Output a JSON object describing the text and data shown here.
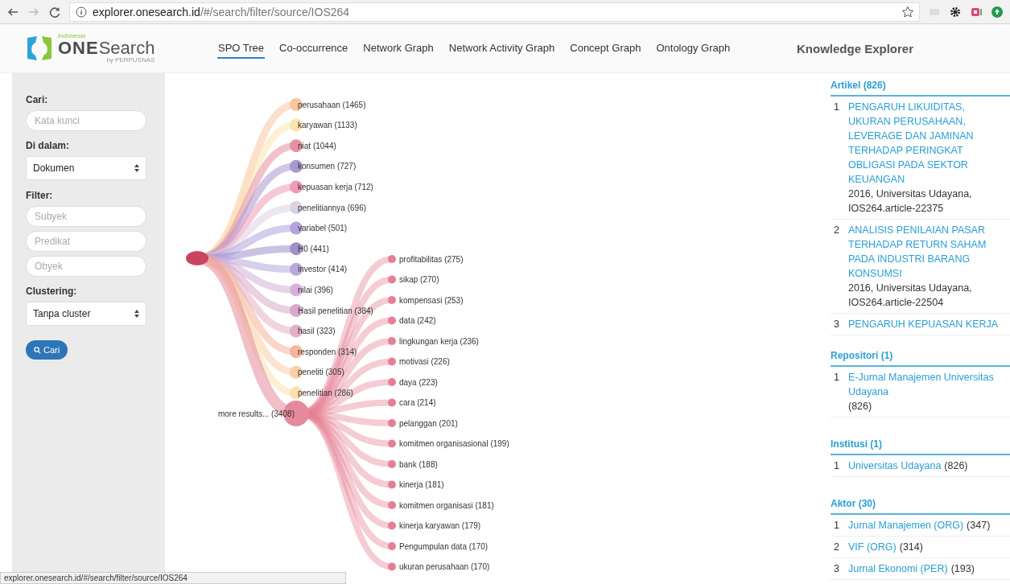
{
  "browser": {
    "url": {
      "host": "explorer.onesearch.id",
      "path": "/#/search/filter/source/IOS264"
    }
  },
  "header": {
    "logo": {
      "small": "indonesia",
      "brand_one": "ONE",
      "brand_search": "Search",
      "tagline": "by PERPUSNAS"
    },
    "tabs": [
      {
        "label": "SPO Tree",
        "selected": true
      },
      {
        "label": "Co-occurrence",
        "selected": false
      },
      {
        "label": "Network Graph",
        "selected": false
      },
      {
        "label": "Network Activity Graph",
        "selected": false
      },
      {
        "label": "Concept Graph",
        "selected": false
      },
      {
        "label": "Ontology Graph",
        "selected": false
      }
    ],
    "panel_title": "Knowledge Explorer"
  },
  "sidebar": {
    "sections": [
      {
        "label": "Cari:",
        "fields": [
          {
            "kind": "input",
            "placeholder": "Kata kunci"
          }
        ]
      },
      {
        "label": "Di dalam:",
        "fields": [
          {
            "kind": "select",
            "value": "Dokumen"
          }
        ]
      },
      {
        "label": "Filter:",
        "fields": [
          {
            "kind": "input",
            "placeholder": "Subyek"
          },
          {
            "kind": "input",
            "placeholder": "Predikat"
          },
          {
            "kind": "input",
            "placeholder": "Obyek"
          }
        ]
      },
      {
        "label": "Clustering:",
        "fields": [
          {
            "kind": "select",
            "value": "Tanpa cluster"
          }
        ]
      }
    ],
    "search_button": "Cari"
  },
  "spo_tree": {
    "children": [
      {
        "label": "perusahaan (1465)",
        "color": "#f9c6a0",
        "kind": "leaf"
      },
      {
        "label": "karyawan (1133)",
        "color": "#fbe3b0",
        "kind": "leaf"
      },
      {
        "label": "niat (1044)",
        "color": "#e58fa0",
        "kind": "leaf"
      },
      {
        "label": "konsumen (727)",
        "color": "#a998cf",
        "kind": "leaf"
      },
      {
        "label": "kepuasan kerja (712)",
        "color": "#ef9ab8",
        "kind": "leaf"
      },
      {
        "label": "penelitiannya (696)",
        "color": "#dcd2e6",
        "kind": "leaf"
      },
      {
        "label": "variabel (501)",
        "color": "#b3a4dd",
        "kind": "leaf"
      },
      {
        "label": "H0 (441)",
        "color": "#9f90c8",
        "kind": "leaf"
      },
      {
        "label": "investor (414)",
        "color": "#b7a8dd",
        "kind": "leaf"
      },
      {
        "label": "nilai (396)",
        "color": "#d6b0d8",
        "kind": "leaf"
      },
      {
        "label": "Hasil penelitian (384)",
        "color": "#d9a9c6",
        "kind": "leaf"
      },
      {
        "label": "hasil (323)",
        "color": "#e3b0c5",
        "kind": "leaf"
      },
      {
        "label": "responden (314)",
        "color": "#f4b59c",
        "kind": "leaf"
      },
      {
        "label": "peneliti (305)",
        "color": "#f9cfa7",
        "kind": "leaf"
      },
      {
        "label": "penelitian (286)",
        "color": "#fbe2b0",
        "kind": "leaf"
      },
      {
        "label": "more results... (3408)",
        "color": "#e58a9a",
        "kind": "more",
        "children": [
          {
            "label": "profitabilitas (275)",
            "color": "#e57f93"
          },
          {
            "label": "sikap (270)",
            "color": "#e57f93"
          },
          {
            "label": "kompensasi (253)",
            "color": "#e57f93"
          },
          {
            "label": "data (242)",
            "color": "#e57f93"
          },
          {
            "label": "lingkungan kerja (236)",
            "color": "#e57f93"
          },
          {
            "label": "motivasi (226)",
            "color": "#e57f93"
          },
          {
            "label": "daya (223)",
            "color": "#e57f93"
          },
          {
            "label": "cara (214)",
            "color": "#e57f93"
          },
          {
            "label": "pelanggan (201)",
            "color": "#e57f93"
          },
          {
            "label": "komitmen organisasional (199)",
            "color": "#e57f93"
          },
          {
            "label": "bank (188)",
            "color": "#e57f93"
          },
          {
            "label": "kinerja (181)",
            "color": "#e57f93"
          },
          {
            "label": "komitmen organisasi (181)",
            "color": "#e57f93"
          },
          {
            "label": "kinerja karyawan (179)",
            "color": "#e57f93"
          },
          {
            "label": "Pengumpulan data (170)",
            "color": "#e57f93"
          },
          {
            "label": "ukuran perusahaan (170)",
            "color": "#e57f93"
          }
        ]
      }
    ]
  },
  "knowledge_explorer": {
    "sections": [
      {
        "title": "Artikel (826)",
        "items": [
          {
            "number": "1",
            "link": "PENGARUH LIKUIDITAS, UKURAN PERUSAHAAN, LEVERAGE DAN JAMINAN TERHADAP PERINGKAT OBLIGASI PADA SEKTOR KEUANGAN",
            "meta": "2016, Universitas Udayana, IOS264.article-22375"
          },
          {
            "number": "2",
            "link": "ANALISIS PENILAIAN PASAR TERHADAP RETURN SAHAM PADA INDUSTRI BARANG KONSUMSI",
            "meta": "2016, Universitas Udayana, IOS264.article-22504"
          },
          {
            "number": "3",
            "link": "PENGARUH KEPUASAN KERJA"
          }
        ]
      },
      {
        "title": "Repositori (1)",
        "items": [
          {
            "number": "1",
            "link": "E-Jurnal Manajemen Universitas Udayana",
            "count": "(826)"
          }
        ]
      },
      {
        "title": "Institusi (1)",
        "items": [
          {
            "number": "1",
            "link": "Universitas Udayana",
            "count": "(826)"
          }
        ]
      },
      {
        "title": "Aktor (30)",
        "items": [
          {
            "number": "1",
            "link": "Jurnal Manajemen (ORG)",
            "count": "(347)"
          },
          {
            "number": "2",
            "link": "VIF (ORG)",
            "count": "(314)"
          },
          {
            "number": "3",
            "link": "Jurnal Ekonomi (PER)",
            "count": "(193)"
          }
        ]
      }
    ]
  },
  "status_bar": "explorer.onesearch.id/#/search/filter/source/IOS264"
}
